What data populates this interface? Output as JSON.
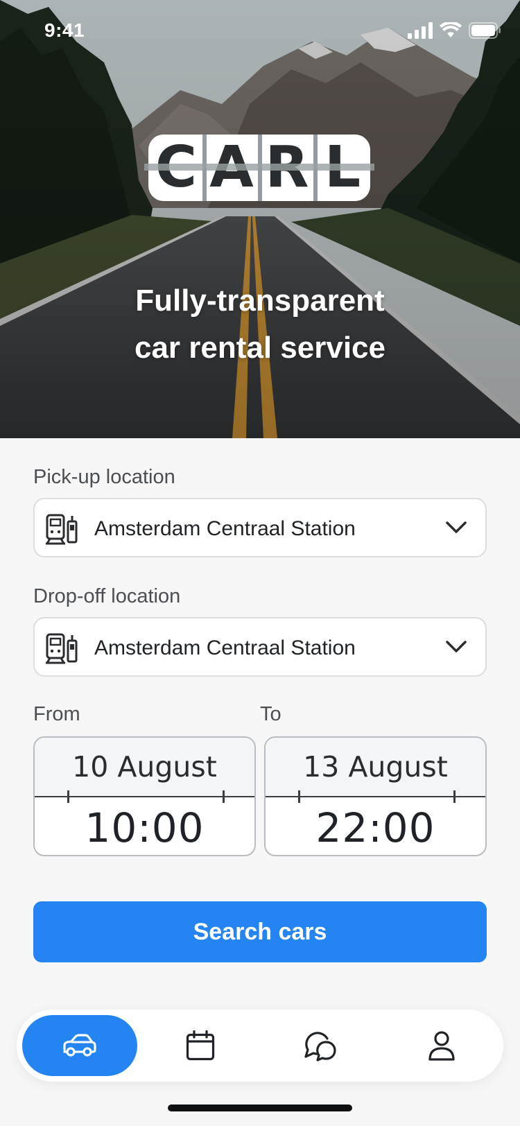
{
  "status_bar": {
    "time": "9:41"
  },
  "hero": {
    "logo_letters": [
      "C",
      "A",
      "R",
      "L"
    ],
    "tagline_line1": "Fully-transparent",
    "tagline_line2": "car rental service"
  },
  "form": {
    "pickup": {
      "label": "Pick-up location",
      "value": "Amsterdam Centraal Station"
    },
    "dropoff": {
      "label": "Drop-off location",
      "value": "Amsterdam Centraal Station"
    },
    "from": {
      "label": "From",
      "date": "10 August",
      "time": "10:00"
    },
    "to": {
      "label": "To",
      "date": "13 August",
      "time": "22:00"
    },
    "search_label": "Search cars"
  },
  "nav": {
    "items": [
      {
        "icon": "car-icon",
        "active": true
      },
      {
        "icon": "calendar-icon",
        "active": false
      },
      {
        "icon": "chat-icon",
        "active": false
      },
      {
        "icon": "profile-icon",
        "active": false
      }
    ]
  },
  "colors": {
    "accent": "#2485f2",
    "background": "#f7f7f8",
    "text": "#1f2226"
  }
}
